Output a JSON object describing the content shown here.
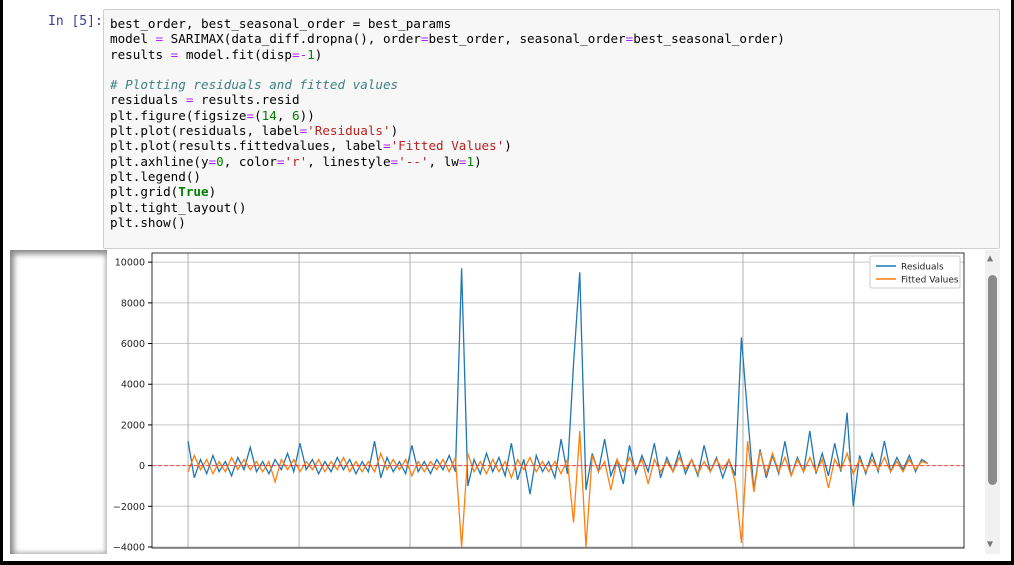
{
  "cell": {
    "prompt": "In [5]:",
    "code": [
      [
        [
          "best_order, best_seasonal_order ",
          ""
        ],
        [
          "=",
          ""
        ],
        [
          " best_params",
          ""
        ]
      ],
      [
        [
          "model ",
          ""
        ],
        [
          "=",
          "op"
        ],
        [
          " SARIMAX(data_diff.dropna(), order",
          ""
        ],
        [
          "=",
          "op"
        ],
        [
          "best_order, seasonal_order",
          ""
        ],
        [
          "=",
          "op"
        ],
        [
          "best_seasonal_order)",
          ""
        ]
      ],
      [
        [
          "results ",
          ""
        ],
        [
          "=",
          "op"
        ],
        [
          " model.fit(disp",
          ""
        ],
        [
          "=-",
          "op"
        ],
        [
          "1",
          "num"
        ],
        [
          ")",
          ""
        ]
      ],
      [],
      [
        [
          "# Plotting residuals and fitted values",
          "cm"
        ]
      ],
      [
        [
          "residuals ",
          ""
        ],
        [
          "=",
          "op"
        ],
        [
          " results.resid",
          ""
        ]
      ],
      [
        [
          "plt.figure(figsize",
          ""
        ],
        [
          "=",
          "op"
        ],
        [
          "(",
          ""
        ],
        [
          "14",
          "num"
        ],
        [
          ", ",
          ""
        ],
        [
          "6",
          "num"
        ],
        [
          "))",
          ""
        ]
      ],
      [
        [
          "plt.plot(residuals, label",
          ""
        ],
        [
          "=",
          "op"
        ],
        [
          "'Residuals'",
          "str"
        ],
        [
          ")",
          ""
        ]
      ],
      [
        [
          "plt.plot(results.fittedvalues, label",
          ""
        ],
        [
          "=",
          "op"
        ],
        [
          "'Fitted Values'",
          "str"
        ],
        [
          ")",
          ""
        ]
      ],
      [
        [
          "plt.axhline(y",
          ""
        ],
        [
          "=",
          "op"
        ],
        [
          "0",
          "num"
        ],
        [
          ", color",
          ""
        ],
        [
          "=",
          "op"
        ],
        [
          "'r'",
          "str"
        ],
        [
          ", linestyle",
          ""
        ],
        [
          "=",
          "op"
        ],
        [
          "'--'",
          "str"
        ],
        [
          ", lw",
          ""
        ],
        [
          "=",
          "op"
        ],
        [
          "1",
          "num"
        ],
        [
          ")",
          ""
        ]
      ],
      [
        [
          "plt.legend()",
          ""
        ]
      ],
      [
        [
          "plt.grid(",
          ""
        ],
        [
          "True",
          "kw"
        ],
        [
          ")",
          ""
        ]
      ],
      [
        [
          "plt.tight_layout()",
          ""
        ]
      ],
      [
        [
          "plt.show()",
          ""
        ]
      ]
    ]
  },
  "chart_data": {
    "type": "line",
    "title": "",
    "xlabel": "",
    "ylabel": "",
    "ylim": [
      -4050,
      10450
    ],
    "xlim": [
      -5.8,
      124.8
    ],
    "grid": true,
    "legend": "top-right",
    "yticks": [
      10000,
      8000,
      6000,
      4000,
      2000,
      0,
      -2000,
      -4000
    ],
    "ytick_labels": [
      "10000",
      "8000",
      "6000",
      "4000",
      "2000",
      "0",
      "−2000",
      "−4000"
    ],
    "xgrid": [
      0,
      17.85,
      35.7,
      53.55,
      71.4,
      89.25,
      107.1,
      124.95
    ],
    "axhline": {
      "y": 0,
      "color": "#ff0000",
      "linestyle": "dashed"
    },
    "series": [
      {
        "name": "Residuals",
        "color": "#1f77b4",
        "values": [
          1200,
          -600,
          300,
          -400,
          500,
          -300,
          200,
          -500,
          400,
          -200,
          900,
          -300,
          200,
          -400,
          300,
          -200,
          600,
          -300,
          1100,
          -200,
          300,
          -400,
          200,
          -300,
          400,
          -200,
          300,
          -400,
          200,
          -300,
          1200,
          -600,
          400,
          -300,
          200,
          -400,
          1000,
          -300,
          200,
          -400,
          300,
          -200,
          500,
          -300,
          9700,
          -1000,
          300,
          -400,
          600,
          -300,
          400,
          -500,
          1100,
          -700,
          300,
          -1400,
          500,
          -300,
          200,
          -600,
          1300,
          -400,
          5000,
          9500,
          -1200,
          600,
          -300,
          1300,
          -500,
          300,
          -900,
          1000,
          -400,
          500,
          -300,
          1100,
          -600,
          400,
          -300,
          700,
          -400,
          300,
          -500,
          1000,
          -300,
          400,
          -600,
          300,
          -500,
          6300,
          2500,
          -1200,
          800,
          -600,
          500,
          -400,
          1200,
          -500,
          400,
          -300,
          1700,
          -400,
          600,
          -500,
          1100,
          -300,
          2600,
          -2000,
          500,
          -400,
          600,
          -300,
          1200,
          -300,
          400,
          -200,
          500,
          -300,
          300,
          100
        ]
      },
      {
        "name": "Fitted Values",
        "color": "#ff7f0e",
        "values": [
          -300,
          500,
          -200,
          300,
          -400,
          200,
          -300,
          400,
          -200,
          300,
          -200,
          200,
          -300,
          200,
          -800,
          300,
          -200,
          300,
          -300,
          200,
          -200,
          300,
          -300,
          200,
          -200,
          400,
          -300,
          200,
          -300,
          200,
          -300,
          600,
          -200,
          300,
          -200,
          300,
          -500,
          200,
          -300,
          200,
          -200,
          300,
          -300,
          400,
          -4000,
          600,
          -300,
          200,
          -400,
          300,
          -300,
          200,
          -600,
          300,
          -200,
          400,
          -300,
          200,
          -300,
          200,
          -400,
          300,
          -2800,
          1700,
          -4000,
          500,
          -300,
          200,
          -1200,
          300,
          -300,
          400,
          -200,
          300,
          -900,
          300,
          -300,
          200,
          -300,
          400,
          -200,
          300,
          -400,
          200,
          -300,
          300,
          -200,
          300,
          -800,
          -3800,
          1200,
          -1300,
          700,
          -400,
          600,
          -300,
          400,
          -500,
          300,
          -300,
          400,
          -300,
          300,
          -1100,
          300,
          -200,
          600,
          -400,
          300,
          -300,
          300,
          -200,
          400,
          -300,
          200,
          -300,
          300,
          -200,
          200,
          100
        ]
      }
    ]
  }
}
